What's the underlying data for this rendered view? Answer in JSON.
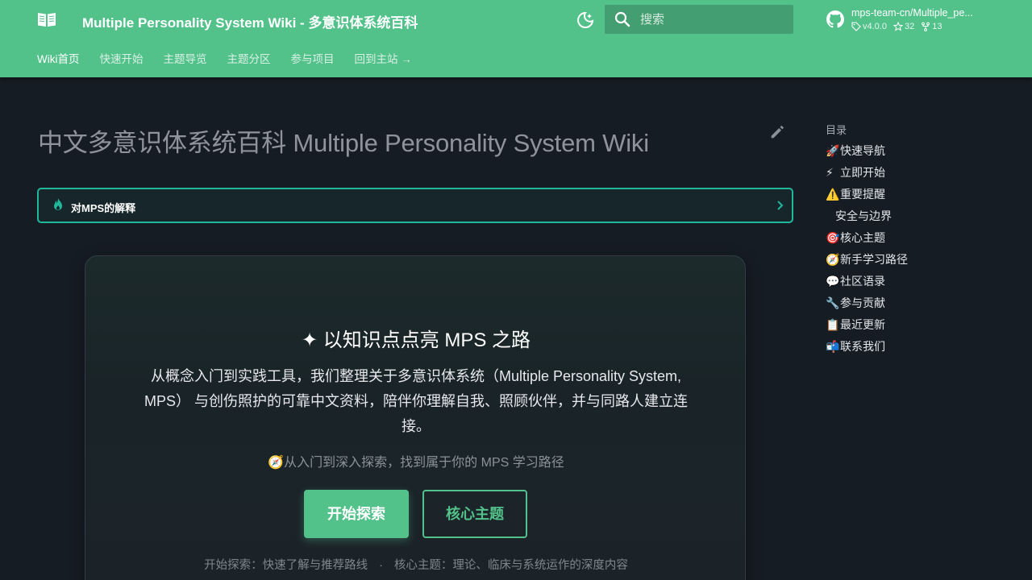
{
  "header": {
    "site_title": "Multiple Personality System Wiki - 多意识体系统百科",
    "search_placeholder": "搜索",
    "repo": {
      "name": "mps-team-cn/Multiple_pe...",
      "version": "v4.0.0",
      "stars": "32",
      "forks": "13"
    },
    "tabs": [
      {
        "label": "Wiki首页",
        "active": true
      },
      {
        "label": "快速开始"
      },
      {
        "label": "主题导览"
      },
      {
        "label": "主题分区"
      },
      {
        "label": "参与项目"
      },
      {
        "label": "回到主站 →"
      }
    ]
  },
  "main": {
    "page_title": "中文多意识体系统百科 Multiple Personality System Wiki",
    "admonition_title": "对MPS的解释",
    "hero": {
      "title": "✦ 以知识点点亮 MPS 之路",
      "description": "从概念入门到实践工具，我们整理关于多意识体系统（Multiple Personality System, MPS） 与创伤照护的可靠中文资料，陪伴你理解自我、照顾伙伴，并与同路人建立连接。",
      "path_text": "🧭从入门到深入探索，找到属于你的 MPS 学习路径",
      "primary_button": "开始探索",
      "secondary_button": "核心主题",
      "foot_left": "开始探索：快速了解与推荐路线",
      "foot_sep": "·",
      "foot_right": "核心主题：理论、临床与系统运作的深度内容"
    }
  },
  "toc": {
    "title": "目录",
    "items": [
      {
        "emoji": "🚀",
        "label": "快速导航"
      },
      {
        "emoji": "⚡",
        "label": "立即开始"
      },
      {
        "emoji": "⚠️",
        "label": "重要提醒"
      },
      {
        "emoji": "",
        "label": "安全与边界",
        "sub": true
      },
      {
        "emoji": "🎯",
        "label": "核心主题"
      },
      {
        "emoji": "🧭",
        "label": "新手学习路径"
      },
      {
        "emoji": "💬",
        "label": "社区语录"
      },
      {
        "emoji": "🔧",
        "label": "参与贡献"
      },
      {
        "emoji": "📋",
        "label": "最近更新"
      },
      {
        "emoji": "📬",
        "label": "联系我们"
      }
    ]
  },
  "colors": {
    "primary": "#52c18a",
    "accent": "#1fb89a",
    "background": "#161c24"
  }
}
